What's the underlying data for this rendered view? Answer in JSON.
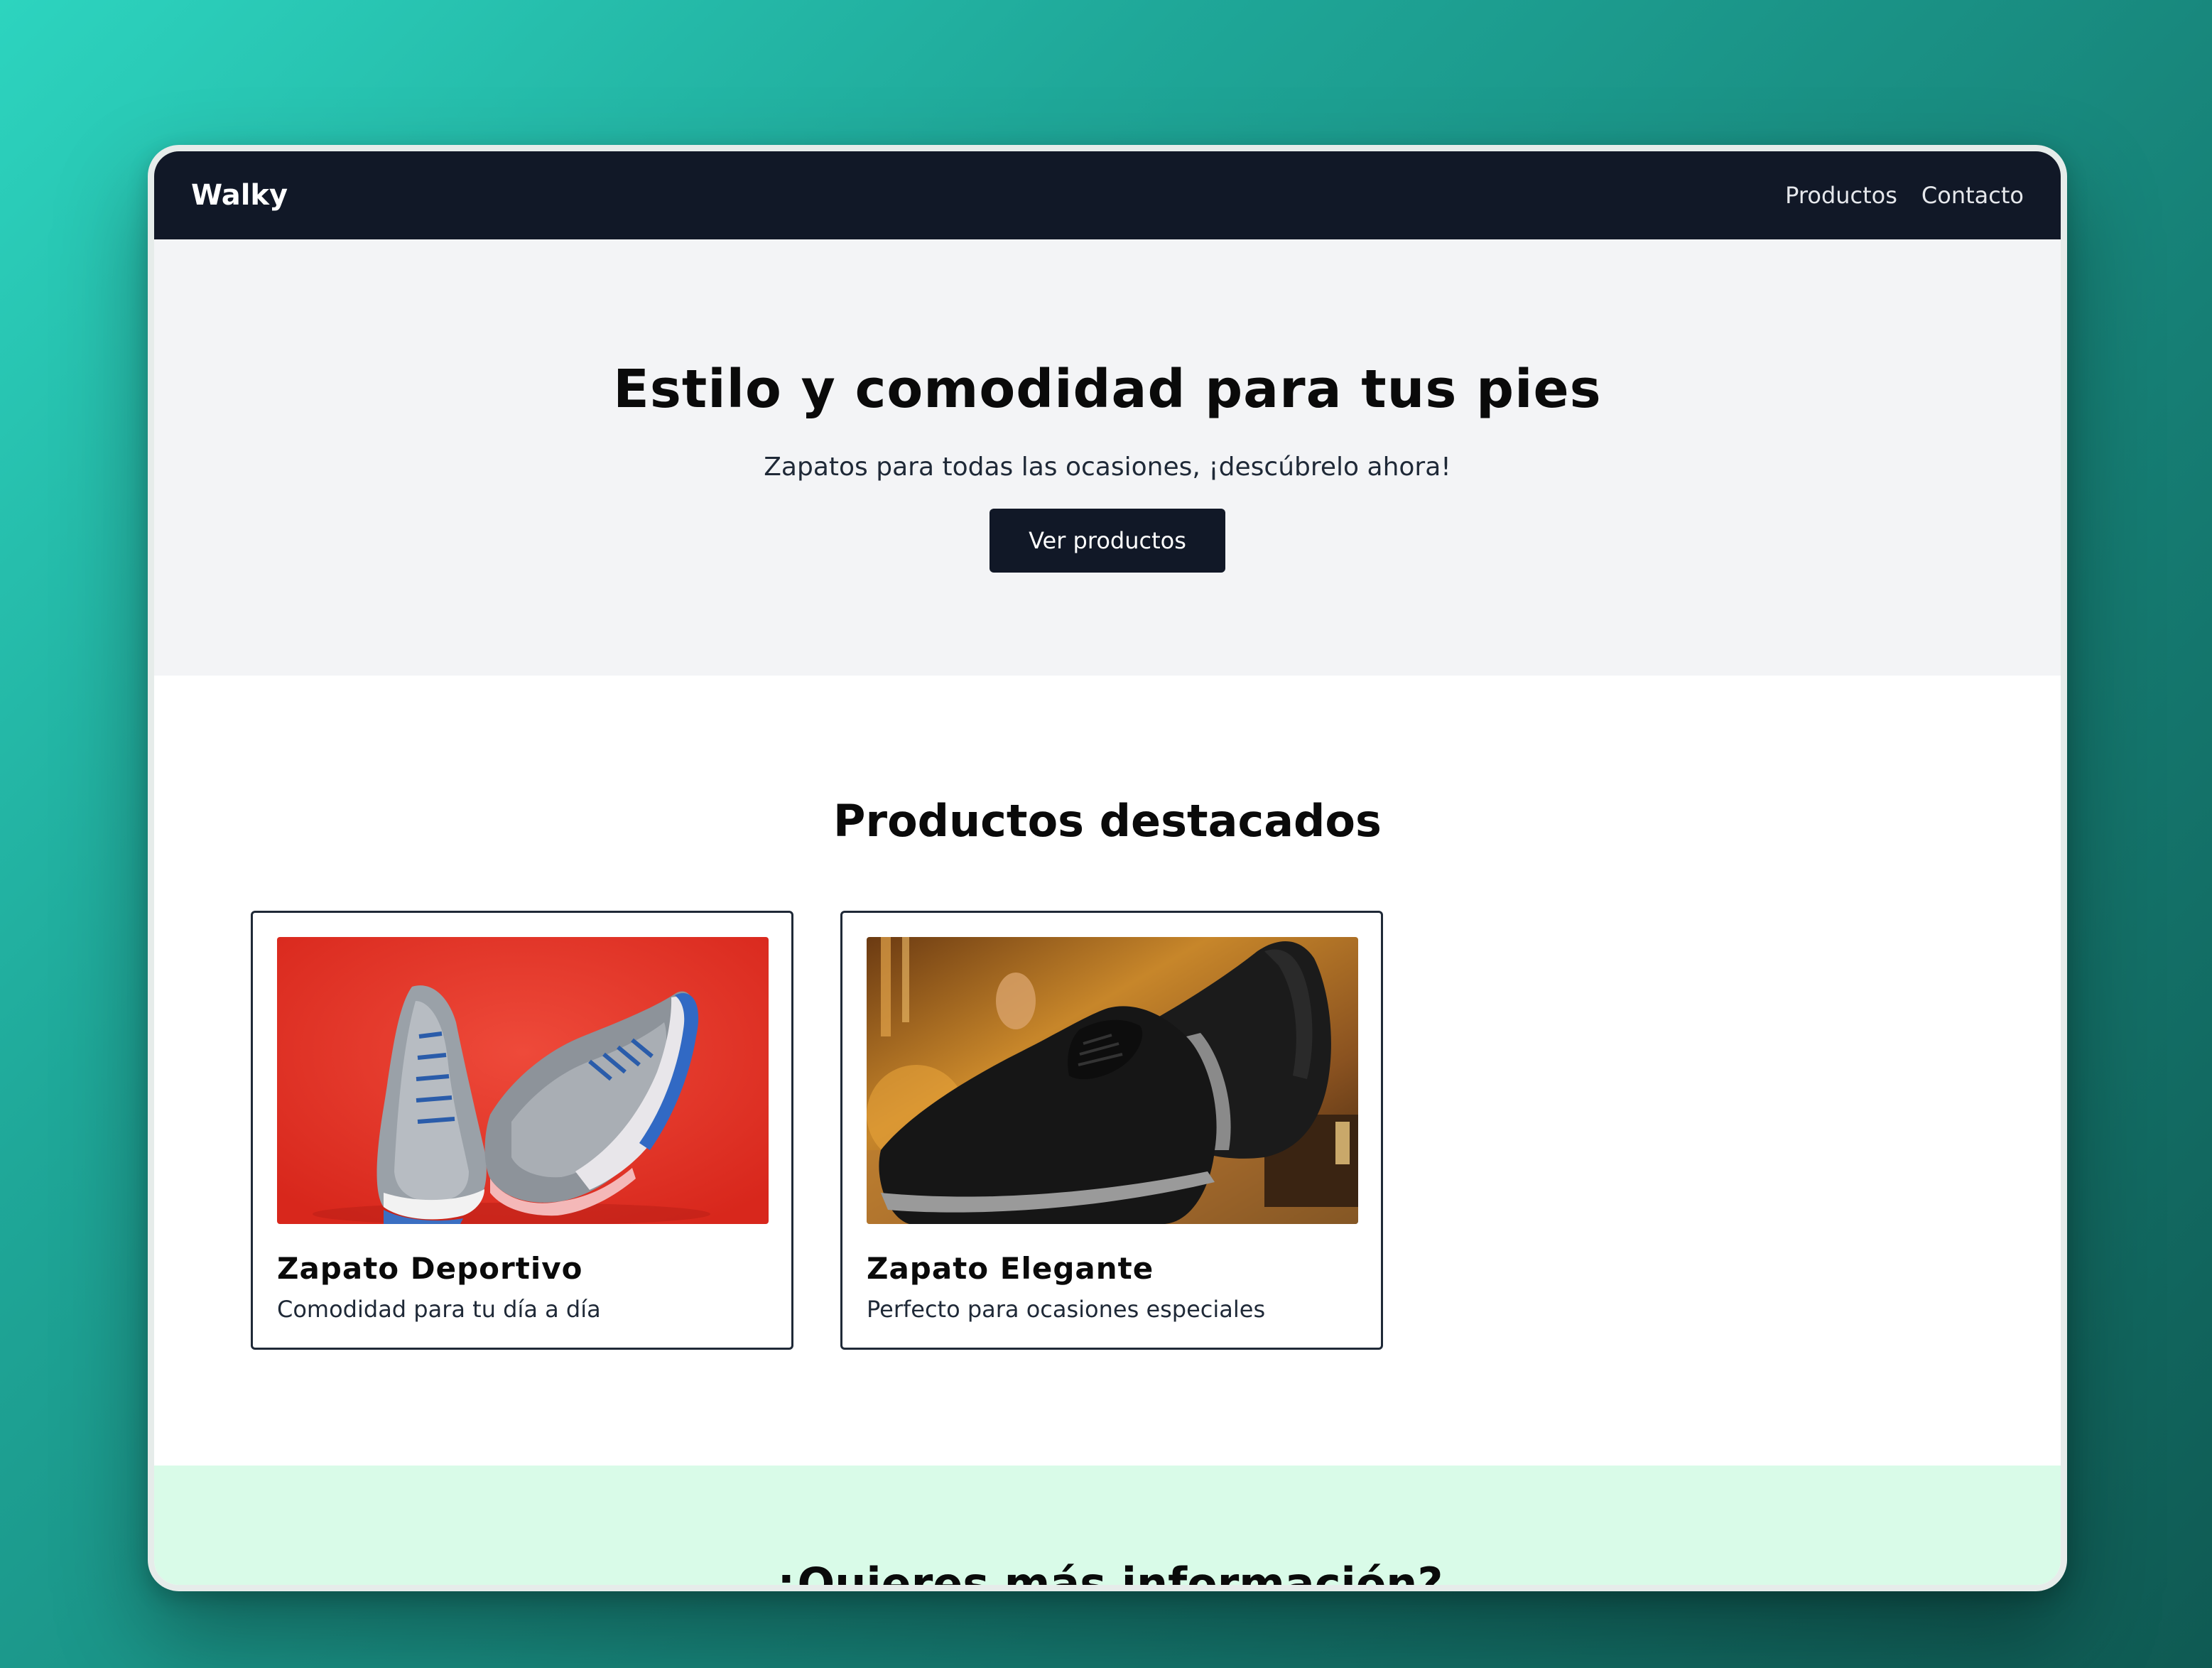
{
  "nav": {
    "brand": "Walky",
    "links": [
      "Productos",
      "Contacto"
    ]
  },
  "hero": {
    "title": "Estilo y comodidad para tus pies",
    "subtitle": "Zapatos para todas las ocasiones, ¡descúbrelo ahora!",
    "button": "Ver productos"
  },
  "products": {
    "title": "Productos destacados",
    "items": [
      {
        "name": "Zapato Deportivo",
        "description": "Comodidad para tu día a día",
        "image": "sneakers-photo"
      },
      {
        "name": "Zapato Elegante",
        "description": "Perfecto para ocasiones especiales",
        "image": "dress-shoe-photo"
      }
    ]
  },
  "contact": {
    "title": "¿Quieres más información?"
  },
  "colors": {
    "nav_bg": "#111827",
    "hero_bg": "#f3f4f6",
    "button_bg": "#111827",
    "contact_bg": "#d9fbe8",
    "backdrop": "#1fa899"
  }
}
